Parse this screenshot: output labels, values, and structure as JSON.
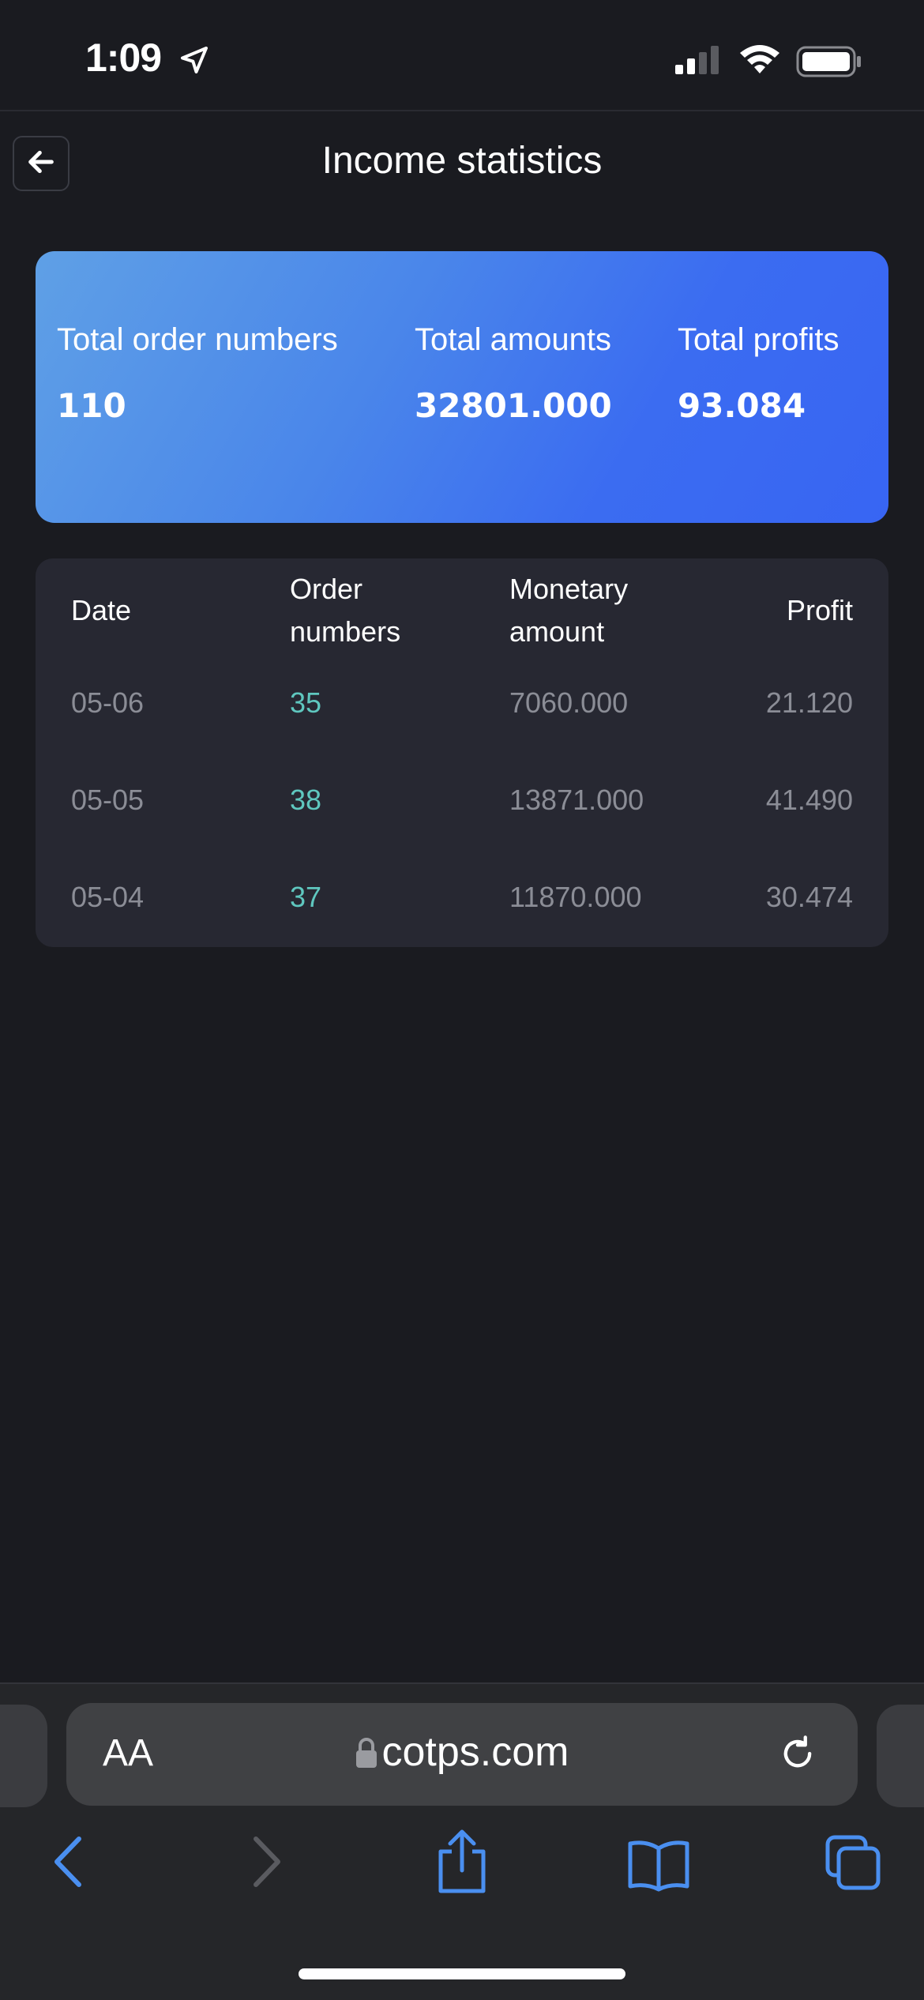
{
  "status_bar": {
    "time": "1:09"
  },
  "header": {
    "title": "Income statistics"
  },
  "summary": {
    "items": [
      {
        "label": "Total order numbers",
        "value": "110"
      },
      {
        "label": "Total amounts",
        "value": "32801.000"
      },
      {
        "label": "Total profits",
        "value": "93.084"
      }
    ]
  },
  "table": {
    "headers": {
      "date": "Date",
      "orders_line1": "Order",
      "orders_line2": "numbers",
      "amount_line1": "Monetary",
      "amount_line2": "amount",
      "profit": "Profit"
    },
    "rows": [
      {
        "date": "05-06",
        "orders": "35",
        "amount": "7060.000",
        "profit": "21.120"
      },
      {
        "date": "05-05",
        "orders": "38",
        "amount": "13871.000",
        "profit": "41.490"
      },
      {
        "date": "05-04",
        "orders": "37",
        "amount": "11870.000",
        "profit": "30.474"
      }
    ]
  },
  "browser": {
    "text_size_label": "AA",
    "url": "cotps.com"
  },
  "colors": {
    "background": "#1a1b20",
    "card": "#272832",
    "accent_teal": "#5fc7bf",
    "gradient_start": "#5fa0e6",
    "gradient_end": "#3865f3",
    "ios_blue": "#4a8ff0"
  },
  "icons": [
    "location-arrow-icon",
    "cellular-signal-icon",
    "wifi-icon",
    "battery-icon",
    "back-arrow-icon",
    "lock-icon",
    "reload-icon",
    "browser-back-icon",
    "browser-forward-icon",
    "share-icon",
    "bookmarks-icon",
    "tabs-icon"
  ]
}
